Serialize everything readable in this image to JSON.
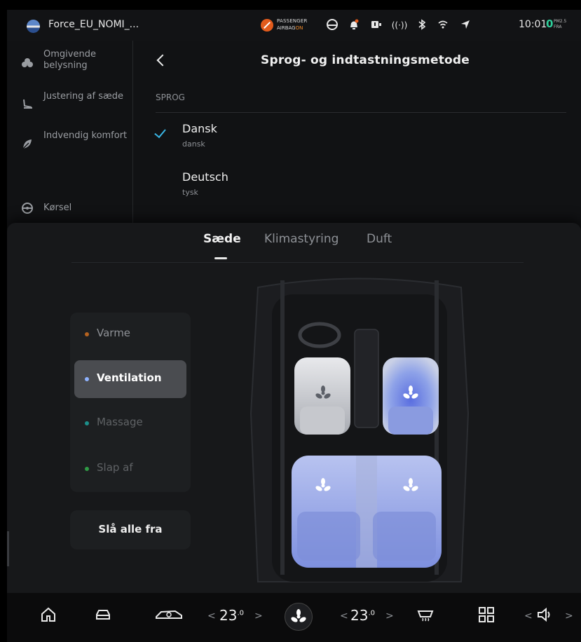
{
  "status_bar": {
    "profile_name": "Force_EU_NOMI_...",
    "airbag_line1": "PASSENGER",
    "airbag_line2_prefix": "AIRBAG",
    "airbag_line2_state": "ON",
    "time": "10:01",
    "pm_value": "0",
    "pm_label1": "PM2.5",
    "pm_label2": "FRA",
    "icons": [
      "steering-wheel-icon",
      "bell-icon",
      "camera-icon",
      "sound-icon",
      "bluetooth-icon",
      "wifi-icon",
      "location-icon"
    ]
  },
  "side_menu": {
    "items": [
      {
        "label": "Omgivende belysning",
        "icon": "ambient-light-icon"
      },
      {
        "label": "Justering af sæde",
        "icon": "seat-adjust-icon"
      },
      {
        "label": "Indvendig komfort",
        "icon": "leaf-icon"
      },
      {
        "label": "Kørsel",
        "icon": "steering-icon"
      }
    ]
  },
  "language_page": {
    "title": "Sprog- og indtastningsmetode",
    "section": "SPROG",
    "languages": [
      {
        "name": "Dansk",
        "native": "dansk",
        "selected": true
      },
      {
        "name": "Deutsch",
        "native": "tysk",
        "selected": false
      }
    ]
  },
  "climate_panel": {
    "tabs": [
      "Sæde",
      "Klimastyring",
      "Duft"
    ],
    "active_tab": "Sæde",
    "modes": [
      {
        "label": "Varme",
        "dot_color": "#b5621f",
        "text_color": "#8e9196",
        "selected": false
      },
      {
        "label": "Ventilation",
        "dot_color": "#8fb3ff",
        "text_color": "#ffffff",
        "selected": true
      },
      {
        "label": "Massage",
        "dot_color": "#1c8f8a",
        "text_color": "#5f6265",
        "selected": false
      },
      {
        "label": "Slap af",
        "dot_color": "#2f9a45",
        "text_color": "#5f6265",
        "selected": false
      }
    ],
    "all_off_label": "Slå alle fra"
  },
  "dock": {
    "left_temp": "23",
    "left_temp_decimal": ".0",
    "right_temp": "23",
    "right_temp_decimal": ".0",
    "icons": [
      "home-icon",
      "car-icon",
      "car-autopilot-icon",
      "fan-icon",
      "defrost-icon",
      "apps-icon",
      "volume-icon"
    ]
  },
  "colors": {
    "accent": "#3ab7e6",
    "pm_good": "#2fcf9b",
    "airbag": "#e25b1c"
  }
}
